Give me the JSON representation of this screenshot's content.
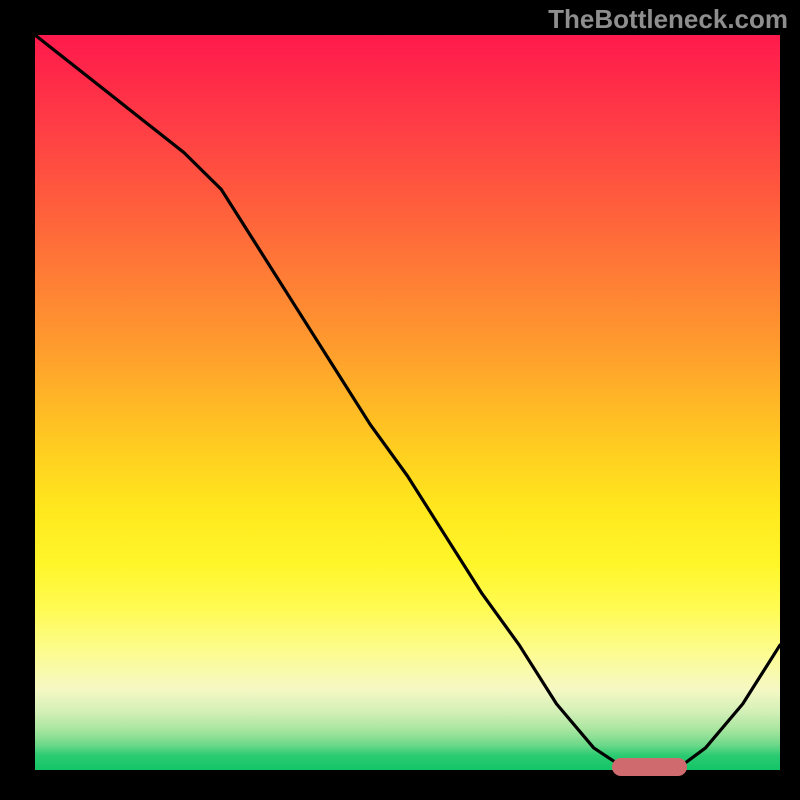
{
  "watermark": "TheBottleneck.com",
  "chart_data": {
    "type": "line",
    "title": "",
    "xlabel": "",
    "ylabel": "",
    "xlim": [
      0,
      100
    ],
    "ylim": [
      0,
      100
    ],
    "x": [
      0,
      5,
      10,
      15,
      20,
      25,
      30,
      35,
      40,
      45,
      50,
      55,
      60,
      65,
      70,
      75,
      78,
      82,
      86,
      90,
      95,
      100
    ],
    "y": [
      100,
      96,
      92,
      88,
      84,
      79,
      71,
      63,
      55,
      47,
      40,
      32,
      24,
      17,
      9,
      3,
      1,
      0,
      0,
      3,
      9,
      17
    ],
    "marker": {
      "x_start": 78,
      "x_end": 87,
      "y": 0
    },
    "colors": {
      "curve": "#000000",
      "marker": "#cf6a6f",
      "background_top": "#ff1a4d",
      "background_bottom": "#12c566"
    }
  }
}
